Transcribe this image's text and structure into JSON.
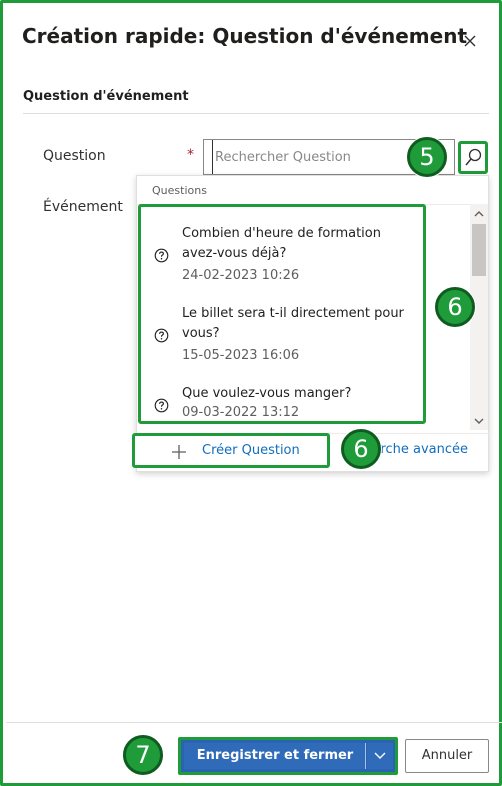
{
  "dialog": {
    "title": "Création rapide: Question d'événement",
    "section_title": "Question d'événement"
  },
  "fields": {
    "question_label": "Question",
    "required_mark": "*",
    "search_placeholder": "Rechercher Question",
    "event_label": "Événement"
  },
  "dropdown": {
    "header": "Questions",
    "items": [
      {
        "question": "Combien d'heure de formation avez-vous déjà?",
        "date": "24-02-2023 10:26",
        "icon": "question-circle-icon"
      },
      {
        "question": "Le billet sera t-il directement pour vous?",
        "date": "15-05-2023 16:06",
        "icon": "question-circle-icon"
      },
      {
        "question": "Que voulez-vous manger?",
        "date": "09-03-2022 13:12",
        "icon": "question-circle-icon"
      }
    ],
    "create_label": "Créer Question",
    "advanced_label": "erche avancée"
  },
  "badges": {
    "search": "5",
    "list": "6",
    "create": "6",
    "save": "7"
  },
  "footer": {
    "save_label": "Enregistrer et fermer",
    "cancel_label": "Annuler"
  },
  "colors": {
    "highlight": "#1f9b3a",
    "primary": "#2f6bb8",
    "link": "#106ebe",
    "required": "#a4262c"
  }
}
